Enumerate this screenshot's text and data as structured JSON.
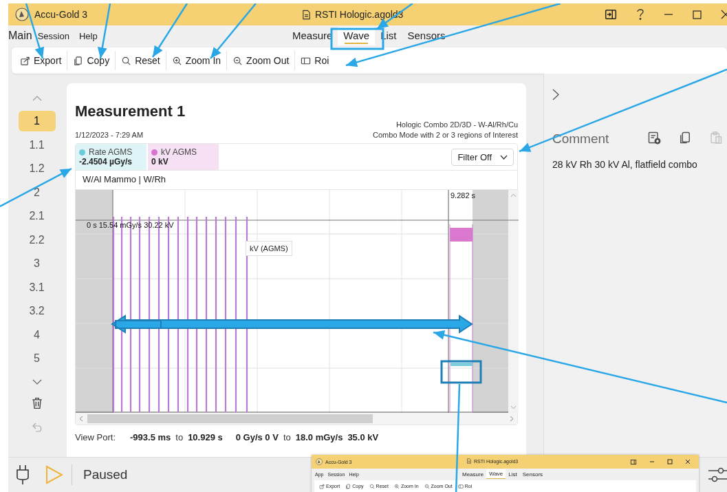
{
  "title_bar": {
    "app_name": "Accu-Gold 3",
    "file_name": "RSTI Hologic.agold3"
  },
  "menu": {
    "title": "Main",
    "items": [
      "Session",
      "Help"
    ]
  },
  "view_tabs": [
    {
      "label": "Measure",
      "selected": false
    },
    {
      "label": "Wave",
      "selected": true
    },
    {
      "label": "List",
      "selected": false
    },
    {
      "label": "Sensors",
      "selected": false
    }
  ],
  "toolbar": [
    {
      "label": "Export",
      "kind": "export"
    },
    {
      "label": "Copy",
      "kind": "copy"
    },
    {
      "label": "Reset",
      "kind": "reset"
    },
    {
      "label": "Zoom In",
      "kind": "zoom-in"
    },
    {
      "label": "Zoom Out",
      "kind": "zoom-out"
    },
    {
      "label": "Roi",
      "kind": "roi"
    }
  ],
  "measurements": [
    {
      "label": "1",
      "selected": true
    },
    {
      "label": "1.1",
      "selected": false
    },
    {
      "label": "1.2",
      "selected": false
    },
    {
      "label": "2",
      "selected": false
    },
    {
      "label": "2.1",
      "selected": false
    },
    {
      "label": "2.2",
      "selected": false
    },
    {
      "label": "3",
      "selected": false
    },
    {
      "label": "3.1",
      "selected": false
    },
    {
      "label": "3.2",
      "selected": false
    },
    {
      "label": "4",
      "selected": false
    },
    {
      "label": "5",
      "selected": false
    }
  ],
  "measurement": {
    "title": "Measurement 1",
    "timestamp": "1/12/2023 - 7:29 AM",
    "device": "Hologic Combo 2D/3D - W-Al/Rh/Cu",
    "mode": "Combo Mode with 2 or 3 regions of Interest",
    "channels": [
      {
        "name": "Rate AGMS",
        "value": "-2.4504 µGy/s",
        "color": "#6ccbdb"
      },
      {
        "name": "kV AGMS",
        "value": "0 kV",
        "color": "#d873cf"
      }
    ],
    "filter": "Filter Off",
    "profile": "W/Al Mammo | W/Rh",
    "wave": {
      "cursor_time": "9.282 s",
      "readout": "0 s 15.54 mGy/s 30.22 kV",
      "tooltip": "kV (AGMS)"
    },
    "view_port": {
      "label": "View Port:",
      "parts": [
        {
          "text": "-993.5 ms",
          "bold": true
        },
        {
          "text": "to",
          "bold": false
        },
        {
          "text": "10.929 s",
          "bold": true
        },
        {
          "text": "0 Gy/s 0 V",
          "bold": true
        },
        {
          "text": "to",
          "bold": false
        },
        {
          "text": "18.0 mGy/s",
          "bold": true
        },
        {
          "text": "35.0 kV",
          "bold": true
        }
      ]
    }
  },
  "comment": {
    "title": "Comment",
    "actions": [
      {
        "kind": "add-note",
        "disabled": false
      },
      {
        "kind": "copy",
        "disabled": false
      },
      {
        "kind": "paste",
        "disabled": true
      }
    ],
    "text": "28 kV Rh 30 kV Al, flatfield combo"
  },
  "status_bar": {
    "state": "Paused"
  },
  "inset_window": {
    "app_name": "Accu-Gold 3",
    "file_name": "RSTI Hologic.agold3",
    "menu": [
      "App",
      "Session",
      "Help"
    ],
    "tabs": [
      {
        "label": "Measure",
        "selected": false
      },
      {
        "label": "Wave",
        "selected": true
      },
      {
        "label": "List",
        "selected": false
      },
      {
        "label": "Sensors",
        "selected": false
      }
    ],
    "toolbar": [
      {
        "label": "Export",
        "kind": "export"
      },
      {
        "label": "Copy",
        "kind": "copy"
      },
      {
        "label": "Reset",
        "kind": "reset"
      },
      {
        "label": "Zoom In",
        "kind": "zoom-in"
      },
      {
        "label": "Zoom Out",
        "kind": "zoom-out"
      },
      {
        "label": "Roi",
        "kind": "roi"
      }
    ]
  }
}
